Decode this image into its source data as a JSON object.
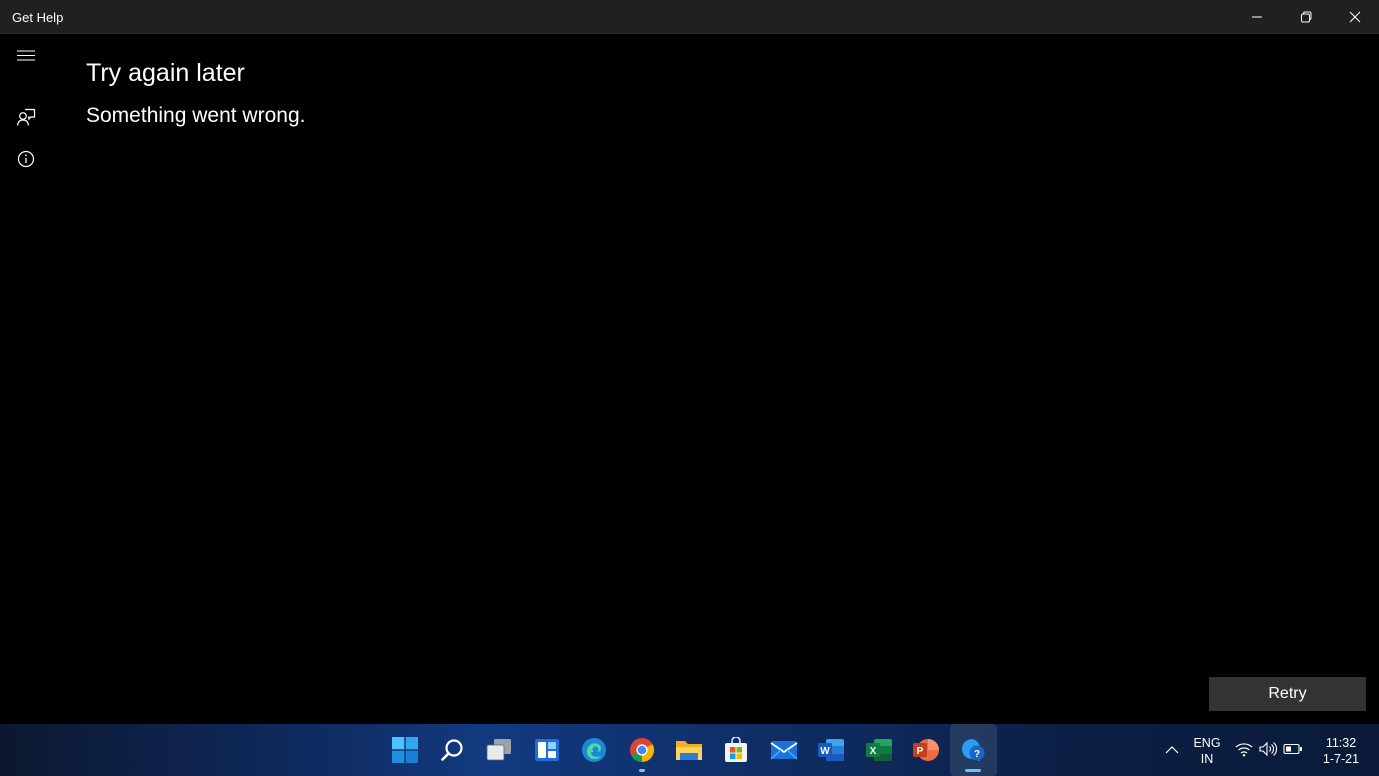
{
  "window": {
    "title": "Get Help"
  },
  "nav": {
    "items": [
      {
        "icon": "hamburger-menu-icon"
      },
      {
        "icon": "contact-support-icon"
      },
      {
        "icon": "info-icon"
      }
    ]
  },
  "content": {
    "title": "Try again later",
    "message": "Something went wrong.",
    "retry_label": "Retry"
  },
  "taskbar": {
    "apps": [
      {
        "icon": "start-icon"
      },
      {
        "icon": "search-icon"
      },
      {
        "icon": "task-view-icon"
      },
      {
        "icon": "widgets-icon"
      },
      {
        "icon": "edge-icon"
      },
      {
        "icon": "chrome-icon",
        "running": true
      },
      {
        "icon": "file-explorer-icon"
      },
      {
        "icon": "store-icon"
      },
      {
        "icon": "mail-icon"
      },
      {
        "icon": "word-icon"
      },
      {
        "icon": "excel-icon"
      },
      {
        "icon": "powerpoint-icon"
      },
      {
        "icon": "get-help-icon",
        "active": true
      }
    ],
    "tray": {
      "language_line1": "ENG",
      "language_line2": "IN",
      "time": "11:32",
      "date": "1-7-21"
    }
  },
  "colors": {
    "titlebar": "#202020",
    "content_bg": "#000000",
    "retry_bg": "#333333",
    "taskbar_accent": "#123a80"
  }
}
